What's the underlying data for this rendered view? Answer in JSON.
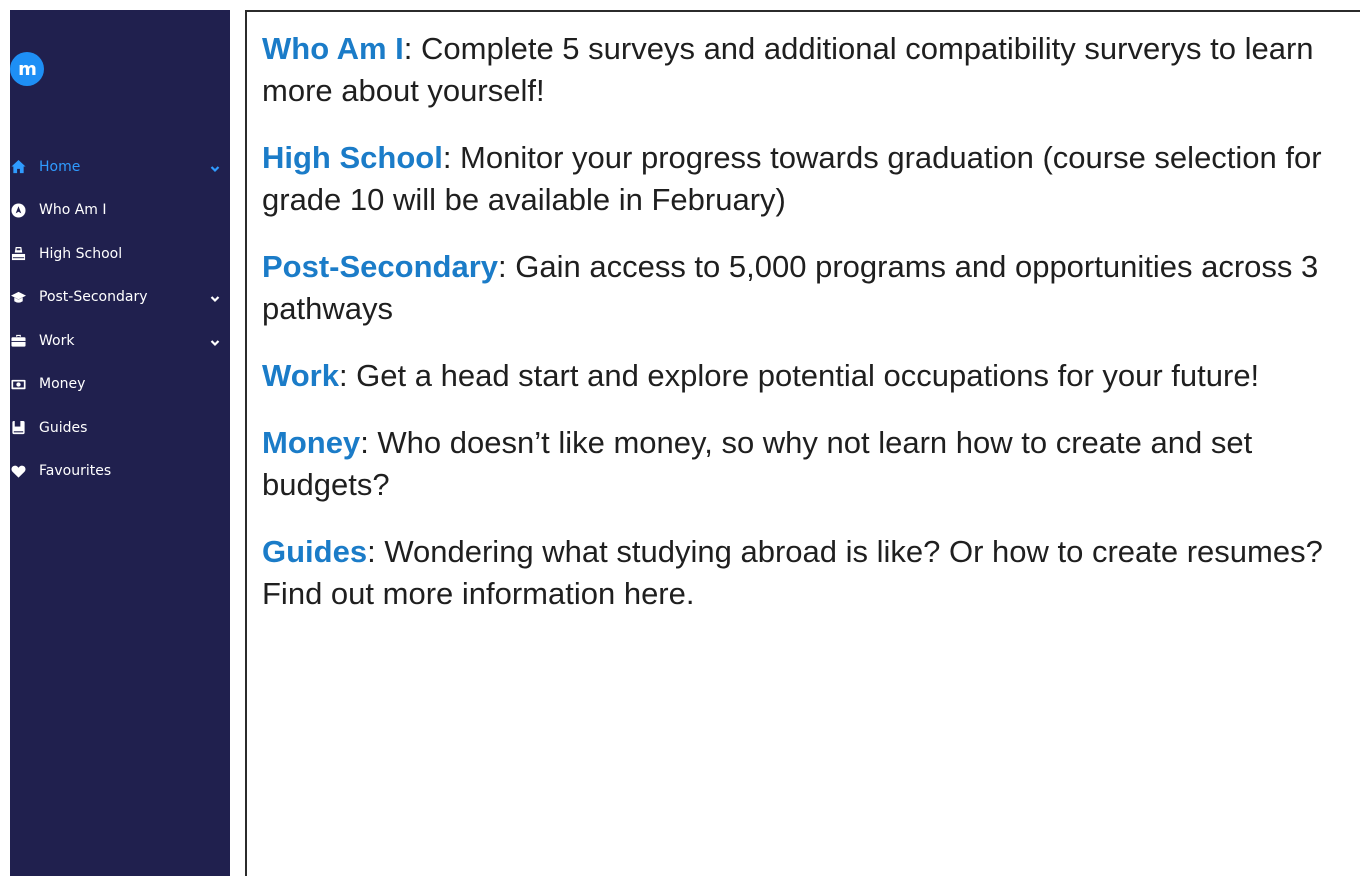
{
  "sidebar": {
    "logo_text": "m",
    "items": [
      {
        "label": "Home",
        "icon": "home-icon",
        "active": true,
        "has_chevron": true
      },
      {
        "label": "Who Am I",
        "icon": "compass-icon",
        "active": false,
        "has_chevron": false
      },
      {
        "label": "High School",
        "icon": "school-icon",
        "active": false,
        "has_chevron": false
      },
      {
        "label": "Post-Secondary",
        "icon": "graduation-cap-icon",
        "active": false,
        "has_chevron": true
      },
      {
        "label": "Work",
        "icon": "briefcase-icon",
        "active": false,
        "has_chevron": true
      },
      {
        "label": "Money",
        "icon": "money-bill-icon",
        "active": false,
        "has_chevron": false
      },
      {
        "label": "Guides",
        "icon": "book-icon",
        "active": false,
        "has_chevron": false
      },
      {
        "label": "Favourites",
        "icon": "heart-icon",
        "active": false,
        "has_chevron": false
      }
    ]
  },
  "content": {
    "paragraphs": [
      {
        "term": "Who Am I",
        "text": ": Complete 5 surveys and additional compatibility surverys to learn more about yourself!"
      },
      {
        "term": "High School",
        "text": ": Monitor your progress towards graduation (course selection for grade 10 will be available in February)"
      },
      {
        "term": "Post-Secondary",
        "text": ": Gain access to 5,000 programs and opportunities across 3 pathways"
      },
      {
        "term": "Work",
        "text": ": Get a head start and explore potential occupations for your future!"
      },
      {
        "term": "Money",
        "text": ": Who doesn’t like money, so why not learn how to create and set budgets?"
      },
      {
        "term": "Guides",
        "text": ": Wondering what studying abroad is like? Or how to create resumes? Find out more information here."
      }
    ]
  },
  "colors": {
    "sidebar_bg": "#20204e",
    "active": "#2f9bff",
    "logo": "#1e8ff5",
    "term": "#1b7cc8",
    "text": "#1f1f1f"
  }
}
